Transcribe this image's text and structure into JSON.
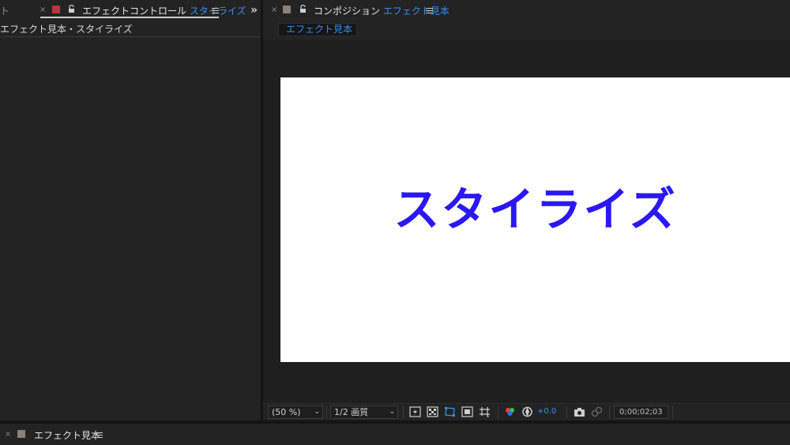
{
  "left_panel": {
    "prev_tab_fragment": "ト",
    "tab": {
      "close": "×",
      "title": "エフェクトコントロール",
      "layer": "スタイライズ",
      "swatch_color": "#b23a3a"
    },
    "breadcrumb": "エフェクト見本・スタイライズ",
    "expand_symbol": "»"
  },
  "composition_panel": {
    "tab": {
      "close": "×",
      "title": "コンポジション",
      "name": "エフェクト見本",
      "swatch_color": "#8a8073"
    },
    "comp_chip": "エフェクト見本",
    "canvas_text": "スタイライズ",
    "canvas_text_color": "#2b18f0"
  },
  "viewer_toolbar": {
    "magnification": "(50 %)",
    "resolution": "1/2 画質",
    "exposure": "+0.0",
    "timecode": "0;00;02;03"
  },
  "timeline_panel": {
    "tab": {
      "close": "×",
      "title": "エフェクト見本",
      "swatch_color": "#8a8073"
    }
  },
  "colors": {
    "accent": "#3a8de8",
    "panel_bg": "#232323"
  }
}
